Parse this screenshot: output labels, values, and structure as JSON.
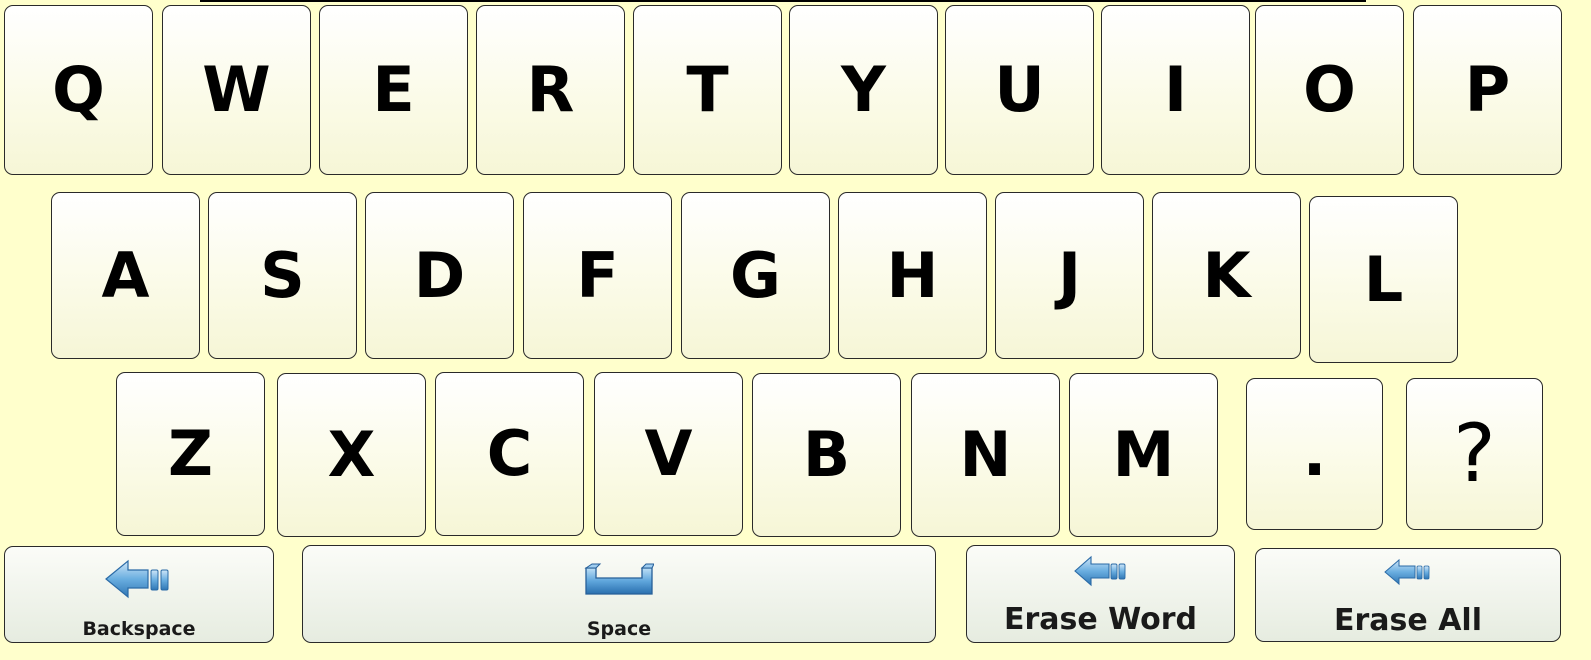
{
  "keyboard": {
    "row1": [
      "Q",
      "W",
      "E",
      "R",
      "T",
      "Y",
      "U",
      "I",
      "O",
      "P"
    ],
    "row2": [
      "A",
      "S",
      "D",
      "F",
      "G",
      "H",
      "J",
      "K",
      "L"
    ],
    "row3": [
      "Z",
      "X",
      "C",
      "V",
      "B",
      "N",
      "M",
      ".",
      "?"
    ],
    "functions": {
      "backspace": {
        "label": "Backspace",
        "icon": "backspace-arrow-icon"
      },
      "space": {
        "label": "Space",
        "icon": "space-bar-icon"
      },
      "erase_word": {
        "label": "Erase Word",
        "icon": "erase-word-arrow-icon"
      },
      "erase_all": {
        "label": "Erase All",
        "icon": "erase-all-arrow-icon"
      }
    }
  },
  "colors": {
    "background": "#ffffcc",
    "key_fill": "#fbfbe8",
    "key_border": "#2a2a2a",
    "icon_blue": "#4a8fc8"
  }
}
